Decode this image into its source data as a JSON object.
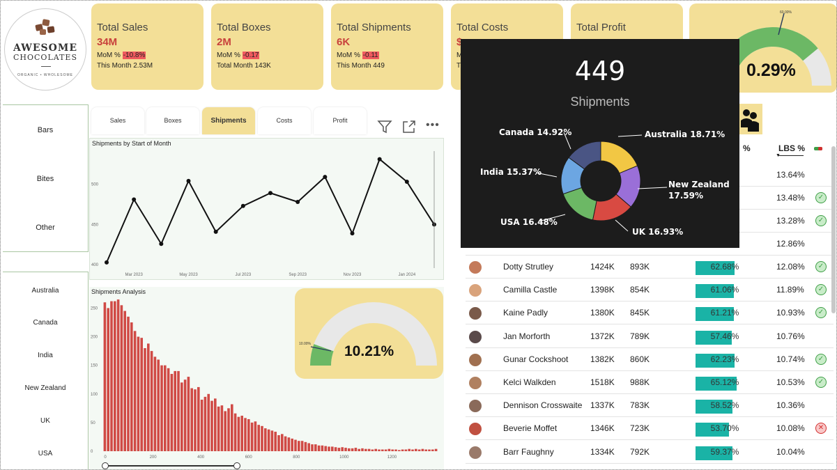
{
  "logo": {
    "brand_line1": "AWESOME",
    "brand_line2": "CHOCOLATES",
    "tagline": "ORGANIC • WHOLESOME"
  },
  "kpis": [
    {
      "title": "Total Sales",
      "value": "34M",
      "mom_label": "MoM %",
      "mom_value": "-10.8%",
      "month_label": "This Month 2.53M"
    },
    {
      "title": "Total Boxes",
      "value": "2M",
      "mom_label": "MoM %",
      "mom_value": "-0.17",
      "month_label": "Total Month 143K"
    },
    {
      "title": "Total Shipments",
      "value": "6K",
      "mom_label": "MoM %",
      "mom_value": "-0.11",
      "month_label": "This Month 449"
    },
    {
      "title": "Total Costs",
      "value": "$",
      "mom_label": "M",
      "mom_value": "",
      "month_label": "T"
    },
    {
      "title": "Total Profit",
      "value": "",
      "mom_label": "",
      "mom_value": "",
      "month_label": ""
    }
  ],
  "profit_gauge": {
    "value_label": "0.29%",
    "target_label": "60.00%",
    "fill_fraction": 0.78
  },
  "product_slicer": [
    "Bars",
    "Bites",
    "Other"
  ],
  "country_slicer": [
    "Australia",
    "Canada",
    "India",
    "New Zealand",
    "UK",
    "USA"
  ],
  "tabs": [
    {
      "label": "Sales",
      "active": false
    },
    {
      "label": "Boxes",
      "active": false
    },
    {
      "label": "Shipments",
      "active": true
    },
    {
      "label": "Costs",
      "active": false
    },
    {
      "label": "Profit",
      "active": false
    }
  ],
  "icons": {
    "filter": "filter-icon",
    "focus": "focus-mode-icon",
    "more": "more-options-icon",
    "people": "people-icon"
  },
  "colors": {
    "accent": "#f3df97",
    "negative": "#f05a5e",
    "bar": "#d04a45",
    "teal": "#1ab3a6",
    "green": "#6cb865"
  },
  "chart_data": [
    {
      "type": "line",
      "title": "Shipments by Start of Month",
      "x": [
        "Feb 2023",
        "Mar 2023",
        "Apr 2023",
        "May 2023",
        "Jun 2023",
        "Jul 2023",
        "Aug 2023",
        "Sep 2023",
        "Oct 2023",
        "Nov 2023",
        "Dec 2023",
        "Jan 2024",
        "Feb 2024"
      ],
      "x_tick_labels": [
        "Mar 2023",
        "May 2023",
        "Jul 2023",
        "Sep 2023",
        "Nov 2023",
        "Jan 2024"
      ],
      "values": [
        402,
        480,
        425,
        503,
        440,
        472,
        488,
        477,
        508,
        438,
        530,
        502,
        449
      ],
      "y_ticks": [
        400,
        450,
        500
      ],
      "ylim": [
        395,
        540
      ]
    },
    {
      "type": "bar",
      "title": "Shipments Analysis",
      "x_ticks": [
        0,
        200,
        400,
        600,
        800,
        1000,
        1200
      ],
      "y_ticks": [
        0,
        50,
        100,
        150,
        200,
        250
      ],
      "ylim": [
        0,
        270
      ],
      "values": [
        260,
        250,
        262,
        262,
        265,
        255,
        245,
        235,
        225,
        210,
        200,
        198,
        180,
        188,
        175,
        165,
        160,
        150,
        150,
        145,
        135,
        140,
        140,
        120,
        125,
        130,
        110,
        108,
        112,
        90,
        95,
        100,
        88,
        92,
        78,
        80,
        70,
        75,
        82,
        66,
        60,
        62,
        58,
        56,
        50,
        52,
        46,
        44,
        40,
        38,
        36,
        34,
        28,
        30,
        26,
        24,
        22,
        20,
        18,
        18,
        16,
        14,
        12,
        12,
        10,
        10,
        9,
        8,
        8,
        7,
        6,
        7,
        6,
        5,
        5,
        6,
        4,
        5,
        4,
        4,
        3,
        4,
        3,
        3,
        3,
        4,
        3,
        3,
        2,
        3,
        3,
        4,
        3,
        4,
        3,
        4,
        3,
        3,
        3,
        4
      ]
    },
    {
      "type": "pie",
      "title": "Shipments",
      "headline": "449",
      "categories": [
        "Australia",
        "New Zealand",
        "UK",
        "USA",
        "India",
        "Canada"
      ],
      "values": [
        18.71,
        17.59,
        16.93,
        16.48,
        15.37,
        14.92
      ],
      "labels": [
        "Australia 18.71%",
        "New Zealand 17.59%",
        "UK 16.93%",
        "USA 16.48%",
        "India 15.37%",
        "Canada 14.92%"
      ],
      "colors": [
        "#f2c744",
        "#9a6fd8",
        "#d84a42",
        "#6cb865",
        "#6ca6e2",
        "#4a5584"
      ]
    }
  ],
  "shipments_gauge": {
    "value_label": "10.21%",
    "target_label": "10.00%",
    "fill_fraction": 0.11
  },
  "table": {
    "headers": {
      "pct": "%",
      "lbs": "LBS %"
    },
    "partial_rows": [
      {
        "lbs": "13.64%"
      },
      {
        "lbs": "13.48%",
        "status": "ok"
      },
      {
        "lbs": "13.28%",
        "status": "ok"
      },
      {
        "lbs": "12.86%"
      }
    ],
    "rows": [
      {
        "name": "Dotty Strutley",
        "c1": "1424K",
        "c2": "893K",
        "pct": "62.68%",
        "fill": 0.6268,
        "lbs": "12.08%",
        "status": "ok"
      },
      {
        "name": "Camilla Castle",
        "c1": "1398K",
        "c2": "854K",
        "pct": "61.06%",
        "fill": 0.6106,
        "lbs": "11.89%",
        "status": "ok"
      },
      {
        "name": "Kaine Padly",
        "c1": "1380K",
        "c2": "845K",
        "pct": "61.21%",
        "fill": 0.6121,
        "lbs": "10.93%",
        "status": "ok"
      },
      {
        "name": "Jan Morforth",
        "c1": "1372K",
        "c2": "789K",
        "pct": "57.46%",
        "fill": 0.5746,
        "lbs": "10.76%",
        "status": ""
      },
      {
        "name": "Gunar Cockshoot",
        "c1": "1382K",
        "c2": "860K",
        "pct": "62.23%",
        "fill": 0.6223,
        "lbs": "10.74%",
        "status": "ok"
      },
      {
        "name": "Kelci Walkden",
        "c1": "1518K",
        "c2": "988K",
        "pct": "65.12%",
        "fill": 0.6512,
        "lbs": "10.53%",
        "status": "ok"
      },
      {
        "name": "Dennison Crosswaite",
        "c1": "1337K",
        "c2": "783K",
        "pct": "58.52%",
        "fill": 0.5852,
        "lbs": "10.36%",
        "status": ""
      },
      {
        "name": "Beverie Moffet",
        "c1": "1346K",
        "c2": "723K",
        "pct": "53.70%",
        "fill": 0.537,
        "lbs": "10.08%",
        "status": "bad"
      },
      {
        "name": "Barr Faughny",
        "c1": "1334K",
        "c2": "792K",
        "pct": "59.37%",
        "fill": 0.5937,
        "lbs": "10.04%",
        "status": ""
      }
    ]
  }
}
